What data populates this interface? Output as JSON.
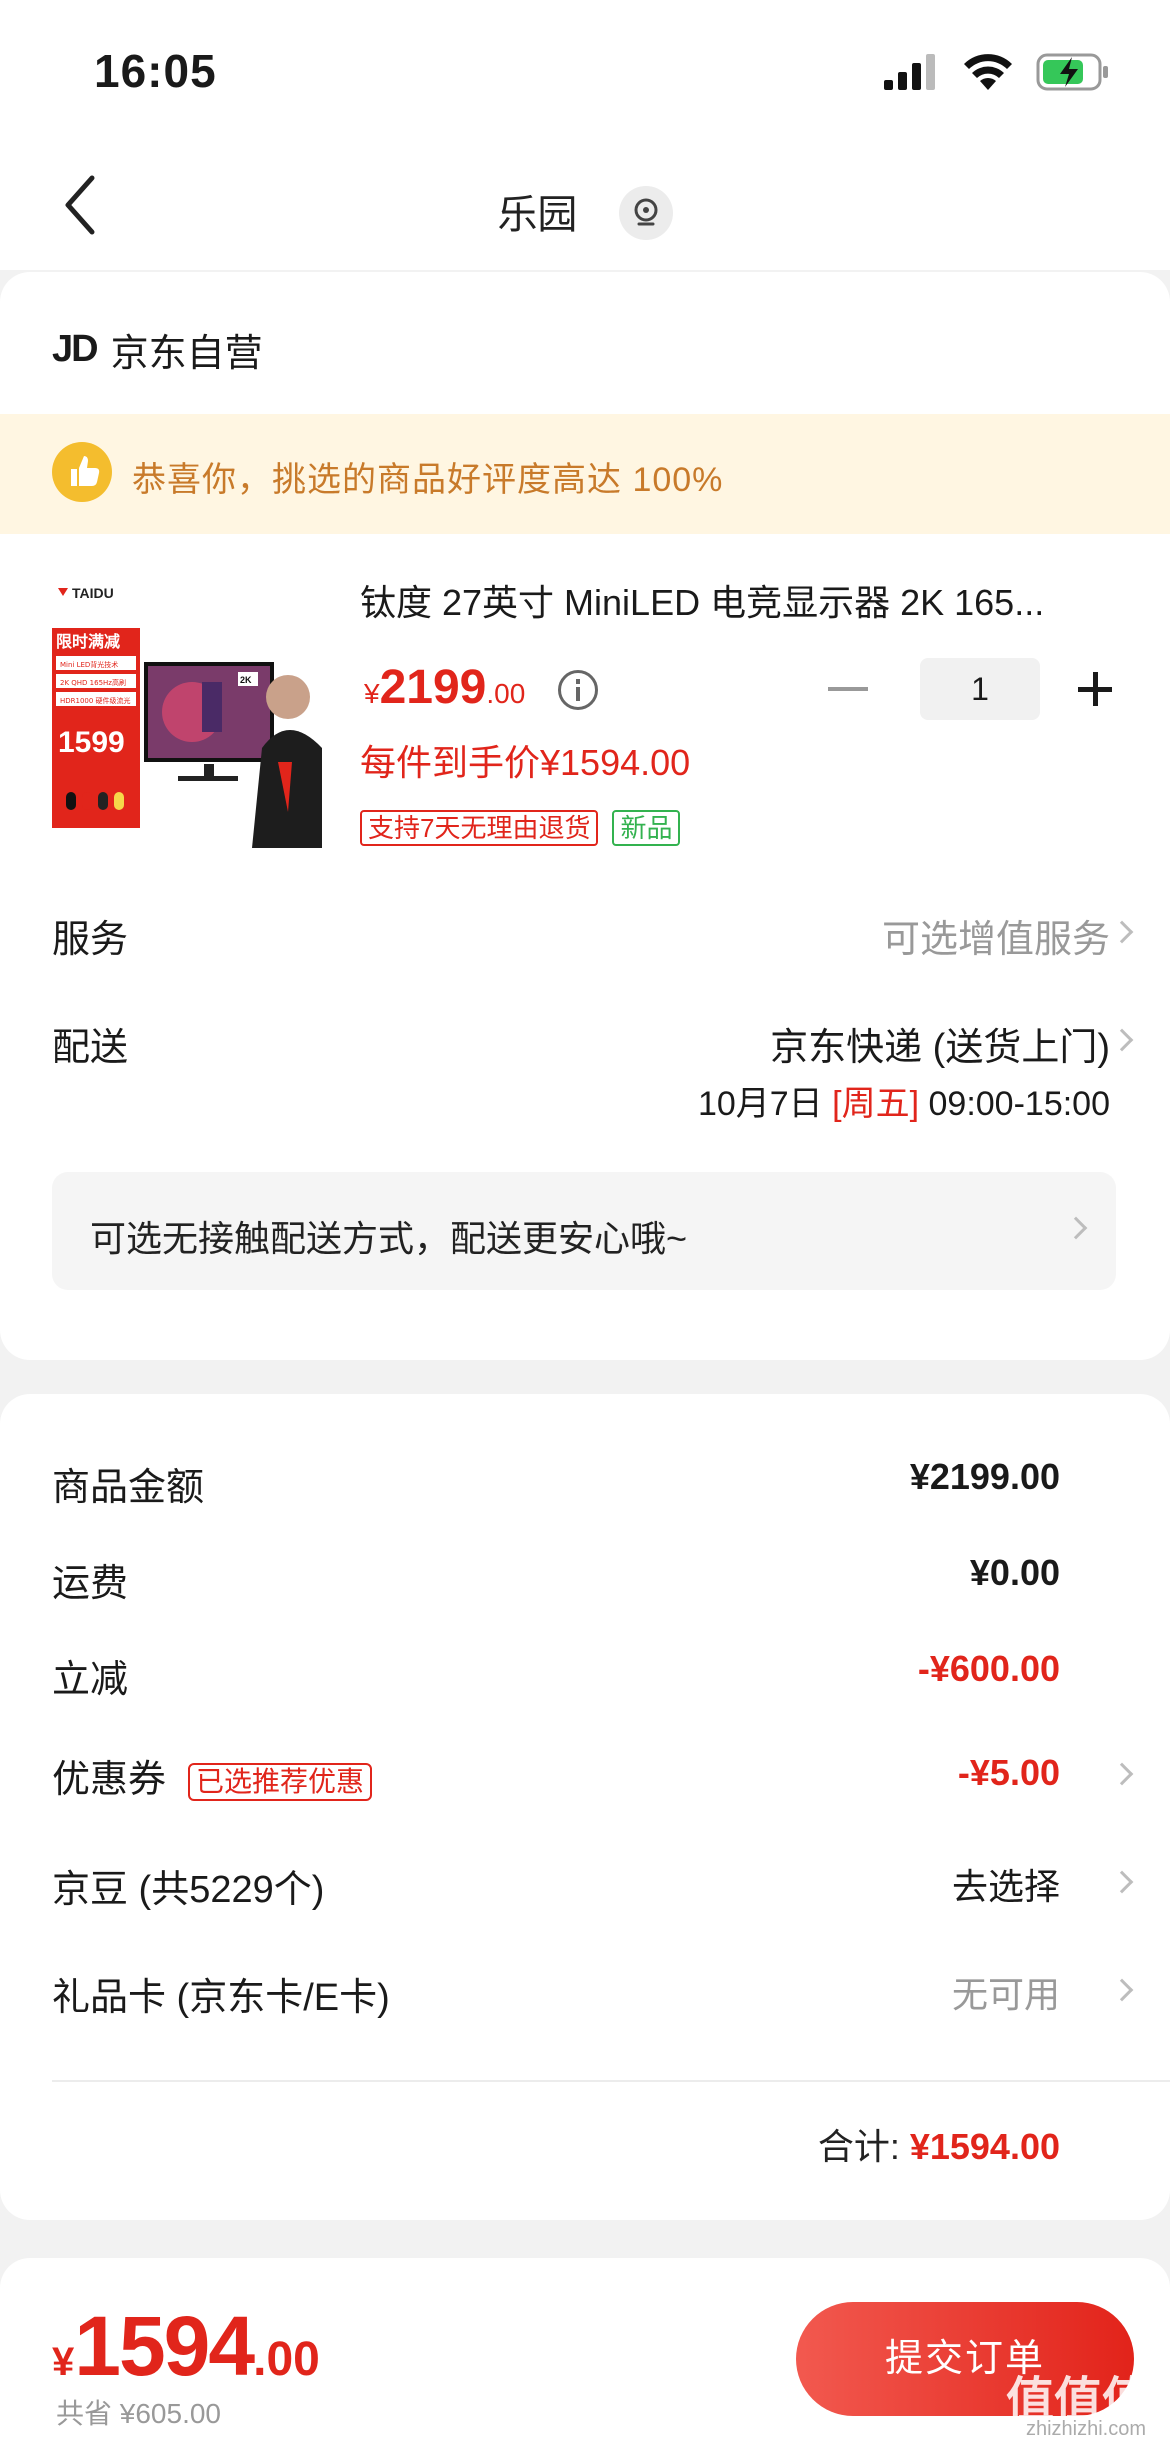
{
  "status_bar": {
    "time": "16:05"
  },
  "nav": {
    "title": "乐园"
  },
  "shop": {
    "logo": "JD",
    "name": "京东自营"
  },
  "praise": {
    "text": "恭喜你，挑选的商品好评度高达 100%"
  },
  "product": {
    "title": "钛度 27英寸 MiniLED 电竞显示器 2K 165...",
    "price_yen": "¥",
    "price_int": "2199",
    "price_dec": ".00",
    "quantity": "1",
    "hand_price": "每件到手价¥1594.00",
    "tags": [
      "支持7天无理由退货",
      "新品"
    ],
    "image_texts": {
      "brand": "TAIDU",
      "promo": "限时满减",
      "line1": "Mini LED背光技术",
      "line2": "2K QHD 165Hz高刷",
      "line3": "HDR1000 硬件级流光",
      "price": "1599"
    }
  },
  "service": {
    "label": "服务",
    "value": "可选增值服务"
  },
  "delivery": {
    "label": "配送",
    "method": "京东快递 (送货上门)",
    "date": "10月7日",
    "weekday": "[周五]",
    "time": "09:00-15:00"
  },
  "contactless": {
    "text": "可选无接触配送方式，配送更安心哦~"
  },
  "summary": {
    "items": [
      {
        "label": "商品金额",
        "value": "¥2199.00"
      },
      {
        "label": "运费",
        "value": "¥0.00"
      },
      {
        "label": "立减",
        "value": "-¥600.00"
      },
      {
        "label": "优惠券",
        "tag": "已选推荐优惠",
        "value": "-¥5.00"
      },
      {
        "label": "京豆 (共5229个)",
        "value": "去选择"
      },
      {
        "label": "礼品卡 (京东卡/E卡)",
        "value": "无可用"
      }
    ],
    "total_label": "合计:",
    "total_value": "¥1594.00"
  },
  "bottom": {
    "yen": "¥",
    "int": "1594",
    "dec": ".00",
    "saved": "共省 ¥605.00",
    "submit": "提交订单"
  },
  "watermark": {
    "main": "值值值",
    "sub": "zhizhizhi.com"
  },
  "colors": {
    "accent": "#e1251b",
    "praise_bg": "#fff6e2",
    "praise_text": "#c87a2a"
  }
}
